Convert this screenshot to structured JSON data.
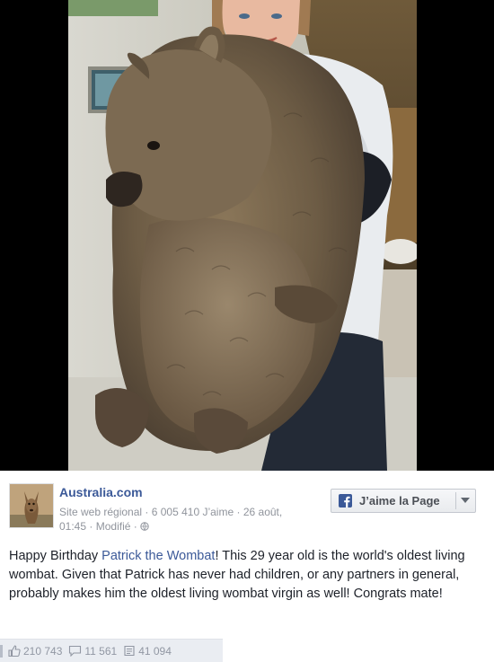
{
  "post": {
    "page_name": "Australia.com",
    "category": "Site web régional",
    "likes_count": "6 005 410 J’aime",
    "date": "26 août, 01:45",
    "modified": "Modifié",
    "like_page_button": "J’aime la Page",
    "text_intro": "Happy Birthday ",
    "text_link": "Patrick the Wombat",
    "text_body": "! This 29 year old is the world's oldest living wombat. Given that Patrick has never had children, or any partners in general, probably makes him the oldest living wombat virgin as well! Congrats mate!"
  },
  "stats": {
    "likes": "210 743",
    "comments": "11 561",
    "shares": "41 094"
  },
  "colors": {
    "link": "#3b5998",
    "meta": "#90949c",
    "stats_bg": "#eaedf2"
  },
  "icons": {
    "globe": "globe-icon",
    "like": "thumbs-up-icon",
    "comment": "comment-icon",
    "share": "share-icon"
  }
}
